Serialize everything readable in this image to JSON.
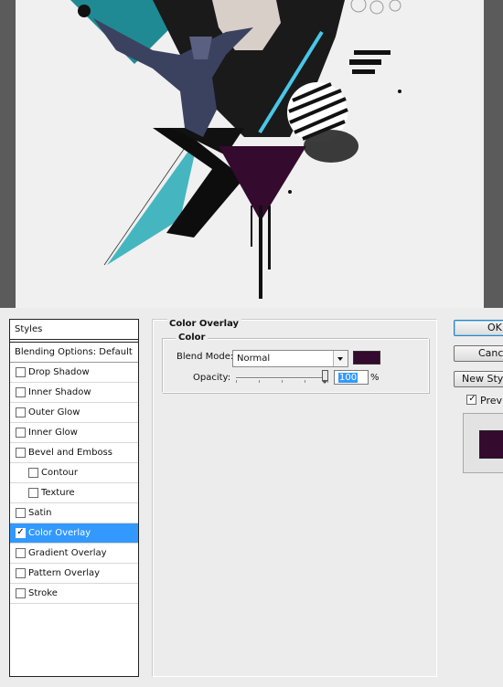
{
  "styles_panel": {
    "header": "Styles",
    "blending_options": "Blending Options: Default",
    "items": [
      {
        "label": "Drop Shadow",
        "checked": false
      },
      {
        "label": "Inner Shadow",
        "checked": false
      },
      {
        "label": "Outer Glow",
        "checked": false
      },
      {
        "label": "Inner Glow",
        "checked": false
      },
      {
        "label": "Bevel and Emboss",
        "checked": false
      },
      {
        "label": "Contour",
        "checked": false
      },
      {
        "label": "Texture",
        "checked": false
      },
      {
        "label": "Satin",
        "checked": false
      },
      {
        "label": "Color Overlay",
        "checked": true
      },
      {
        "label": "Gradient Overlay",
        "checked": false
      },
      {
        "label": "Pattern Overlay",
        "checked": false
      },
      {
        "label": "Stroke",
        "checked": false
      }
    ]
  },
  "color_overlay": {
    "group_title": "Color Overlay",
    "subgroup_title": "Color",
    "blend_mode_label": "Blend Mode:",
    "blend_mode_value": "Normal",
    "opacity_label": "Opacity:",
    "opacity_value": "100",
    "opacity_unit": "%",
    "opacity_level": 1.0,
    "overlay_color": "#340a2f"
  },
  "buttons": {
    "ok": "OK",
    "cancel": "Cancel",
    "new_style": "New Style...",
    "preview_label": "Preview",
    "preview_checked": true
  },
  "colors": {
    "selection": "#3399ff",
    "canvas_bg": "#5b5b5b",
    "dialog_bg": "#ececec"
  }
}
